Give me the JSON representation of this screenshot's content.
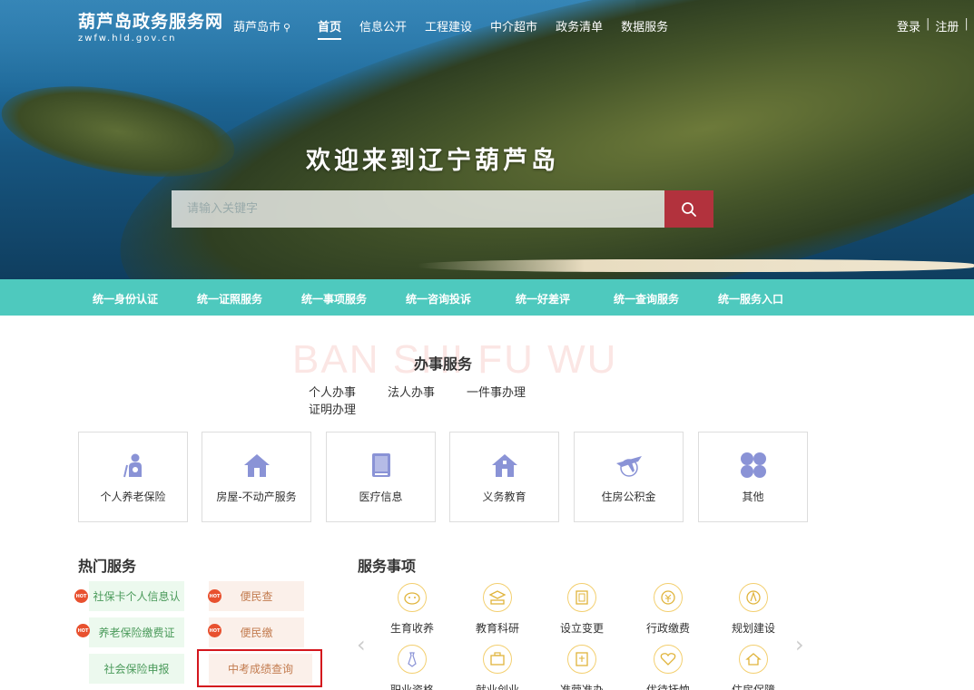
{
  "header": {
    "site_name": "葫芦岛政务服务网",
    "domain": "zwfw.hld.gov.cn",
    "city": "葫芦岛市",
    "nav": [
      {
        "label": "首页",
        "active": true
      },
      {
        "label": "信息公开"
      },
      {
        "label": "工程建设"
      },
      {
        "label": "中介超市"
      },
      {
        "label": "政务清单"
      },
      {
        "label": "数据服务"
      }
    ],
    "login": "登录",
    "register": "注册",
    "extra": "无"
  },
  "hero": {
    "welcome": "欢迎来到辽宁葫芦岛",
    "search_placeholder": "请输入关键字"
  },
  "teal_bar": [
    "统一身份认证",
    "统一证照服务",
    "统一事项服务",
    "统一咨询投诉",
    "统一好差评",
    "统一查询服务",
    "统一服务入口"
  ],
  "banshi": {
    "watermark": "BAN SHI FU WU",
    "title": "办事服务",
    "tabs": [
      "个人办事",
      "法人办事",
      "一件事办理",
      "证明办理"
    ],
    "cards": [
      {
        "label": "个人养老保险",
        "icon": "elderly-person-icon"
      },
      {
        "label": "房屋-不动产服务",
        "icon": "house-icon"
      },
      {
        "label": "医疗信息",
        "icon": "medical-book-icon"
      },
      {
        "label": "义务教育",
        "icon": "school-house-icon"
      },
      {
        "label": "住房公积金",
        "icon": "airplane-icon"
      },
      {
        "label": "其他",
        "icon": "grid-icon"
      }
    ]
  },
  "hot": {
    "title": "热门服务",
    "badge": "HOT",
    "items": [
      {
        "label": "社保卡个人信息认",
        "hot": true
      },
      {
        "label": "便民查",
        "hot": true
      },
      {
        "label": "养老保险缴费证",
        "hot": true
      },
      {
        "label": "便民缴",
        "hot": true
      },
      {
        "label": "社会保险申报",
        "hot": false
      },
      {
        "label": "中考成绩查询",
        "hot": false
      }
    ]
  },
  "services": {
    "title": "服务事项",
    "items": [
      {
        "label": "生育收养",
        "icon": "baby-icon"
      },
      {
        "label": "教育科研",
        "icon": "education-icon"
      },
      {
        "label": "设立变更",
        "icon": "document-frame-icon"
      },
      {
        "label": "行政缴费",
        "icon": "payment-icon"
      },
      {
        "label": "规划建设",
        "icon": "planning-icon"
      },
      {
        "label": "职业资格",
        "icon": "tie-icon"
      },
      {
        "label": "就业创业",
        "icon": "briefcase-icon"
      },
      {
        "label": "准营准办",
        "icon": "permit-icon"
      },
      {
        "label": "优待抚恤",
        "icon": "heart-icon"
      },
      {
        "label": "住房保障",
        "icon": "housing-icon"
      }
    ],
    "prev": "‹",
    "next": "›"
  },
  "colors": {
    "teal": "#4ec9be",
    "search_button": "#b2323d",
    "highlight": "#d4161d",
    "icon": "#8a93d6"
  }
}
